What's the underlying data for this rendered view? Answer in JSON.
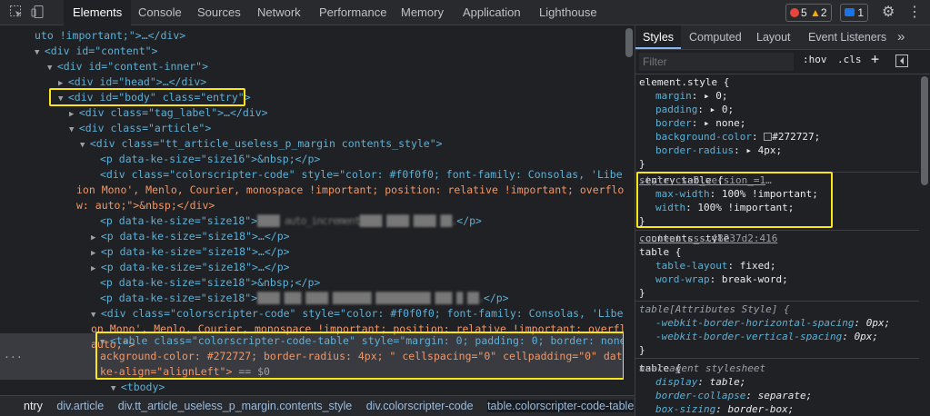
{
  "toolbar": {
    "tabs": [
      "Elements",
      "Console",
      "Sources",
      "Network",
      "Performance",
      "Memory",
      "Application",
      "Lighthouse"
    ],
    "active_tab": "Elements",
    "errors": "5",
    "warnings": "2",
    "issues": "1",
    "colors": {
      "error": "#e8453c",
      "warning": "#f9ab00",
      "issue": "#1a73e8"
    }
  },
  "dom": {
    "l0": "uto !important;\">…</div>",
    "l1_tag": "<div id=\"content\">",
    "l2_tag": "<div id=\"content-inner\">",
    "l3_tag": "<div id=\"head\">…</div>",
    "l4_tag": "<div id=\"body\" class=\"entry\">",
    "l5_tag": "<div class=\"tag_label\">…</div>",
    "l6_tag": "<div class=\"article\">",
    "l7_tag": "<div class=\"tt_article_useless_p_margin contents_style\">",
    "l8": "<p data-ke-size=\"size16\">&nbsp;</p>",
    "l9": "<div class=\"colorscripter-code\" style=\"color: #f0f0f0; font-family: Consolas, 'Liberat",
    "l10": "ion Mono', Menlo, Courier, monospace !important; position: relative !important; overflo",
    "l11": "w: auto;\">&nbsp;</div>",
    "l12a": "<p data-ke-size=\"size18\">",
    "l12b": "████ auto_increment████ ████ ████ ██.",
    "l12c": "</p>",
    "l13": "<p data-ke-size=\"size18\">…</p>",
    "l14": "<p data-ke-size=\"size18\">…</p>",
    "l15": "<p data-ke-size=\"size18\">…</p>",
    "l16": "<p data-ke-size=\"size18\">&nbsp;</p>",
    "l17a": "<p data-ke-size=\"size18\">",
    "l17b": "████ ███ ████ ███████ ██████████ ███ █ ██.",
    "l17c": "</p>",
    "l18": "<div class=\"colorscripter-code\" style=\"color: #f0f0f0; font-family: Consolas, 'Liberati",
    "l19": "on Mono', Menlo, Courier, monospace !important; position: relative !important; overflow:",
    "l20": "auto;\">",
    "l21": "<table class=\"colorscripter-code-table\" style=\"margin: 0; padding: 0; border: none; b",
    "l22": "ackground-color: #272727; border-radius: 4px; \" cellspacing=\"0\" cellpadding=\"0\" data-",
    "l23a": "ke-align=\"alignLeft\">",
    "l23b": " == $0",
    "l24": "<tbody>",
    "ellipsis": "···"
  },
  "breadcrumbs": [
    "ntry",
    "div.article",
    "div.tt_article_useless_p_margin.contents_style",
    "div.colorscripter-code",
    "table.colorscripter-code-table"
  ],
  "styles": {
    "tabs": [
      "Styles",
      "Computed",
      "Layout",
      "Event Listeners"
    ],
    "more": "»",
    "filter_placeholder": "Filter",
    "hov": ":hov",
    "cls": ".cls",
    "plus": "+",
    "element_style": {
      "selector": "element.style {",
      "props": [
        [
          "margin",
          "▸ 0;"
        ],
        [
          "padding",
          "▸ 0;"
        ],
        [
          "border",
          "▸ none;"
        ],
        [
          "background-color",
          "#272727;"
        ],
        [
          "border-radius",
          "▸ 4px;"
        ]
      ],
      "close": "}"
    },
    "entry_table": {
      "selector": ".entry table {",
      "source": "style.css?_version_=1388692:139",
      "props": [
        [
          "max-width",
          "100% !important;"
        ],
        [
          "width",
          "100% !important;"
        ]
      ],
      "close": "}"
    },
    "contents_style": {
      "selector1": ".contents_style",
      "selector2": "table {",
      "source": "content.css…48237d2:416",
      "props": [
        [
          "table-layout",
          "fixed;"
        ],
        [
          "word-wrap",
          "break-word;"
        ]
      ],
      "close": "}"
    },
    "attr_style": {
      "selector": "table[Attributes Style] {",
      "props": [
        [
          "-webkit-border-horizontal-spacing",
          "0px;"
        ],
        [
          "-webkit-border-vertical-spacing",
          "0px;"
        ]
      ],
      "close": "}"
    },
    "ua": {
      "selector": "table {",
      "source": "user agent stylesheet",
      "props": [
        [
          "display",
          "table;"
        ],
        [
          "border-collapse",
          "separate;"
        ],
        [
          "box-sizing",
          "border-box;"
        ]
      ]
    }
  }
}
